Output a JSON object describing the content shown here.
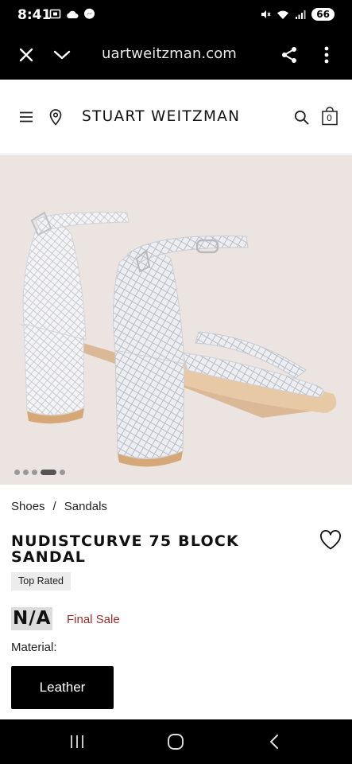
{
  "status_bar": {
    "time": "8:41",
    "battery": "66",
    "left_icons": [
      "screenshot-icon",
      "cloud-icon",
      "messenger-icon"
    ],
    "right_icons": [
      "mute-icon",
      "wifi-icon",
      "signal-icon"
    ]
  },
  "browser": {
    "url": "uartweitzman.com",
    "icons": [
      "close-icon",
      "chevron-down-icon",
      "share-icon",
      "more-vert-icon"
    ]
  },
  "header": {
    "logo": "STUART WEITZMAN",
    "cart_count": "0",
    "icons": [
      "menu-icon",
      "location-pin-icon",
      "search-icon",
      "shopping-bag-icon"
    ]
  },
  "gallery": {
    "slide_count": 5,
    "active_slide": 4
  },
  "product": {
    "breadcrumb": [
      "Shoes",
      "/",
      "Sandals"
    ],
    "title": "NUDISTCURVE 75 BLOCK SANDAL",
    "badge": "Top Rated",
    "price": "N/A",
    "sale_note": "Final Sale",
    "material_label": "Material:",
    "material_option": "Leather"
  },
  "colors": {
    "final_sale": "#9b2c2c",
    "hero_bg": "#ece4e1"
  },
  "nav_bar": {
    "icons": [
      "recent-apps-icon",
      "home-icon",
      "back-icon"
    ]
  }
}
